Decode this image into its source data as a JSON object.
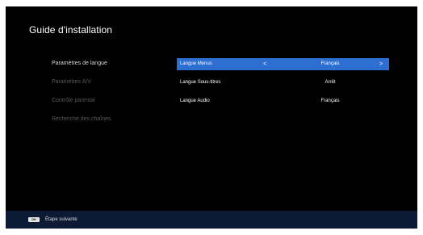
{
  "title": "Guide d'installation",
  "menu": [
    {
      "label": "Paramètres de langue",
      "active": true
    },
    {
      "label": "Paramètres A/V",
      "active": false
    },
    {
      "label": "Contrôle parental",
      "active": false
    },
    {
      "label": "Recherche des chaînes",
      "active": false
    }
  ],
  "settings": [
    {
      "label": "Langue Menus",
      "value": "Français",
      "selected": true,
      "arrow_left": "<",
      "arrow_right": ">"
    },
    {
      "label": "Langue Sous-titres",
      "value": "Arrêt",
      "selected": false
    },
    {
      "label": "Langue Audio",
      "value": "Français",
      "selected": false
    }
  ],
  "footer": {
    "key_label": "OK",
    "hint": "Étape suivante"
  },
  "colors": {
    "selection": "#2d6fd1",
    "footer_bg": "#0c1a35",
    "background": "#000000"
  }
}
